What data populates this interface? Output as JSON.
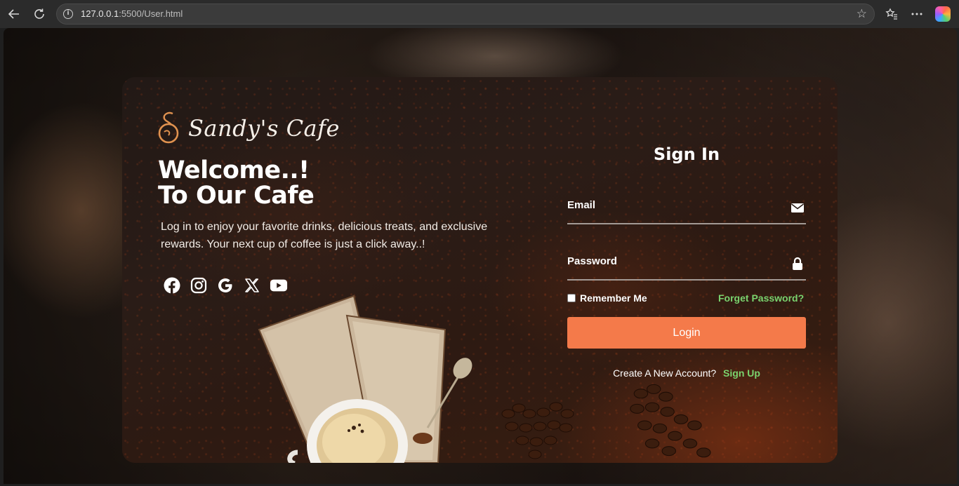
{
  "browser": {
    "url_host": "127.0.0.1",
    "url_rest": ":5500/User.html",
    "icons": [
      "back-arrow-icon",
      "reload-icon",
      "site-info-icon",
      "favorite-star-icon",
      "favorites-icon",
      "more-menu-icon",
      "copilot-icon"
    ]
  },
  "brand": {
    "name": "Sandy's Cafe",
    "logo": "cafe-swirl-logo"
  },
  "hero": {
    "welcome_line1": "Welcome..!",
    "welcome_line2": "To Our Cafe",
    "tagline": "Log in to enjoy your favorite drinks, delicious treats, and exclusive rewards. Your next cup of coffee is just a click away..!"
  },
  "socials": [
    {
      "name": "facebook-icon"
    },
    {
      "name": "instagram-icon"
    },
    {
      "name": "google-icon"
    },
    {
      "name": "x-icon"
    },
    {
      "name": "youtube-icon"
    }
  ],
  "form": {
    "title": "Sign In",
    "email_label": "Email",
    "password_label": "Password",
    "remember_label": "Remember Me",
    "forget_label": "Forget Password?",
    "login_label": "Login",
    "create_prompt": "Create A New Account?",
    "signup_label": "Sign Up"
  },
  "colors": {
    "accent_button": "#f47a4a",
    "link_green": "#7ad36e",
    "card_dark": "#221916"
  }
}
